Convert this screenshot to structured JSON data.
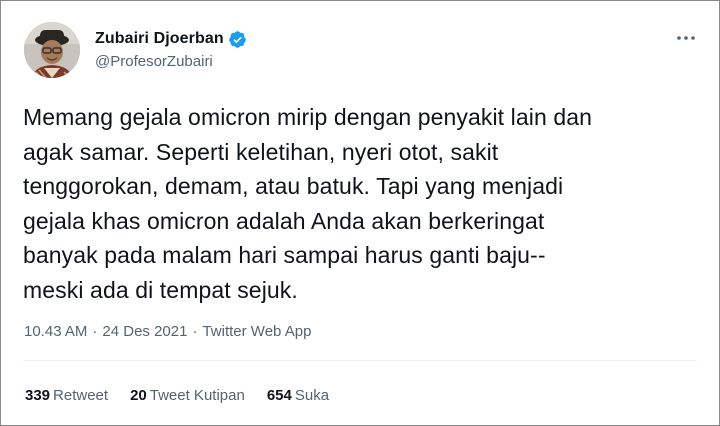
{
  "author": {
    "display_name": "Zubairi Djoerban",
    "handle": "@ProfesorZubairi",
    "verified": true
  },
  "icons": {
    "verified": "verified-badge-icon",
    "more": "more-options-icon"
  },
  "colors": {
    "verified_blue": "#1d9bf0",
    "text_primary": "#0f1419",
    "text_secondary": "#536471"
  },
  "tweet": {
    "text": "Memang gejala omicron mirip dengan penyakit lain dan\nagak samar. Seperti keletihan, nyeri otot, sakit\ntenggorokan, demam, atau batuk. Tapi yang menjadi\ngejala khas omicron adalah Anda akan berkeringat\nbanyak pada malam hari sampai harus ganti baju--\nmeski ada di tempat sejuk.",
    "time": "10.43 AM",
    "separator": "·",
    "date": "24 Des 2021",
    "source": "Twitter Web App"
  },
  "stats": {
    "retweets": {
      "count": "339",
      "label": "Retweet"
    },
    "quotes": {
      "count": "20",
      "label": "Tweet Kutipan"
    },
    "likes": {
      "count": "654",
      "label": "Suka"
    }
  }
}
